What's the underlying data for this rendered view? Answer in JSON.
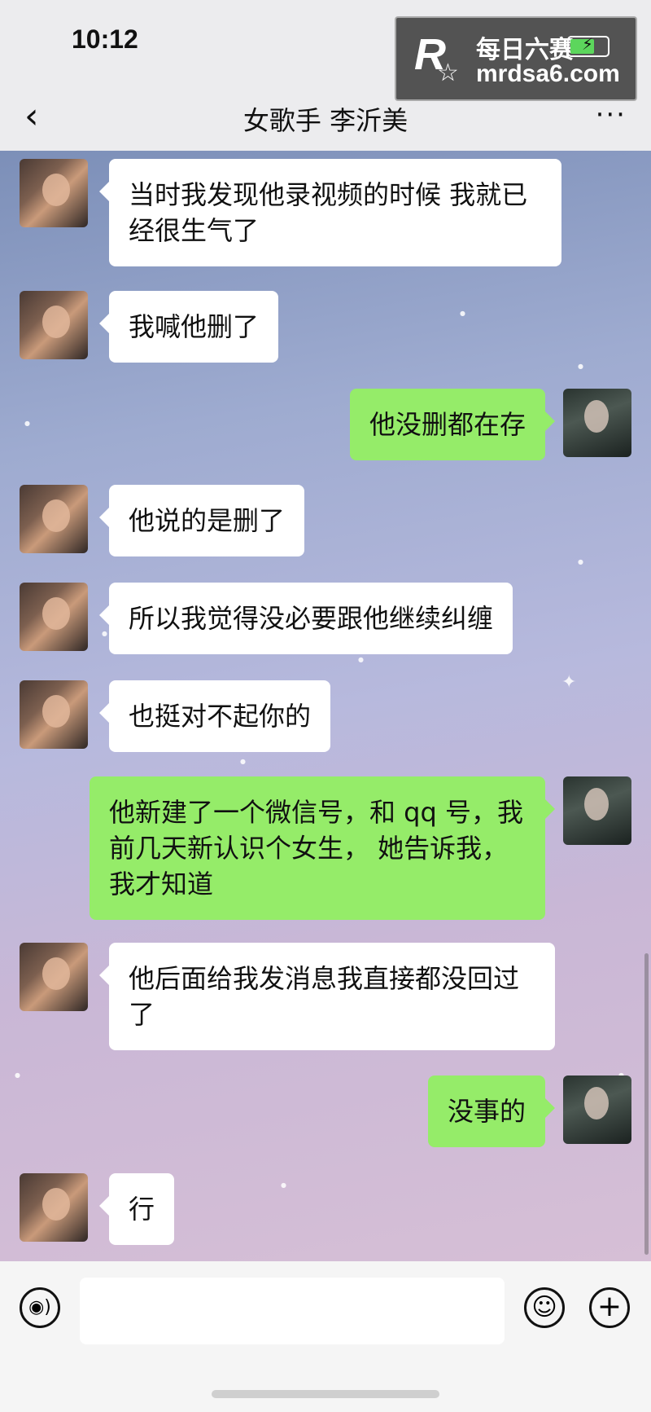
{
  "status_bar": {
    "time": "10:12"
  },
  "watermark": {
    "logo": "R",
    "line1": "每日六赛",
    "line2": "mrdsa6.com"
  },
  "header": {
    "back_icon": "‹",
    "title": "女歌手 李沂美",
    "more_icon": "···"
  },
  "messages": [
    {
      "side": "left",
      "text": "当时我发现他录视频的时候 我就已经很生气了"
    },
    {
      "side": "left",
      "text": "我喊他删了"
    },
    {
      "side": "right",
      "text": "他没删都在存"
    },
    {
      "side": "left",
      "text": "他说的是删了"
    },
    {
      "side": "left",
      "text": "所以我觉得没必要跟他继续纠缠"
    },
    {
      "side": "left",
      "text": "也挺对不起你的"
    },
    {
      "side": "right",
      "text": "他新建了一个微信号，和 qq 号，我前几天新认识个女生， 她告诉我，我才知道"
    },
    {
      "side": "left",
      "text": "他后面给我发消息我直接都没回过了"
    },
    {
      "side": "right",
      "text": "没事的"
    },
    {
      "side": "left",
      "text": "行"
    }
  ],
  "input_bar": {
    "voice_icon": "voice-icon",
    "emoji_icon": "emoji-icon",
    "plus_icon": "plus-icon",
    "input_value": ""
  },
  "colors": {
    "bubble_left": "#ffffff",
    "bubble_right": "#95ec69",
    "header_bg": "#ececee"
  }
}
